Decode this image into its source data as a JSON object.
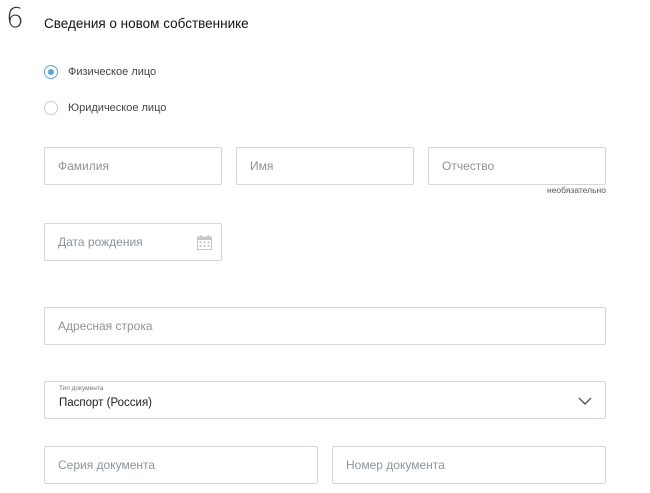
{
  "section": {
    "number": "6",
    "title": "Сведения о новом собственнике"
  },
  "owner_type": {
    "options": [
      {
        "label": "Физическое лицо",
        "selected": true
      },
      {
        "label": "Юридическое лицо",
        "selected": false
      }
    ]
  },
  "fields": {
    "last_name": {
      "placeholder": "Фамилия",
      "value": ""
    },
    "first_name": {
      "placeholder": "Имя",
      "value": ""
    },
    "patronymic": {
      "placeholder": "Отчество",
      "value": "",
      "hint": "необязательно"
    },
    "birth_date": {
      "placeholder": "Дата рождения",
      "value": ""
    },
    "address": {
      "placeholder": "Адресная строка",
      "value": ""
    },
    "document_type": {
      "caption": "Тип документа",
      "value": "Паспорт (Россия)"
    },
    "document_series": {
      "placeholder": "Серия документа",
      "value": ""
    },
    "document_number": {
      "placeholder": "Номер документа",
      "value": ""
    }
  },
  "icons": {
    "calendar": "calendar-icon",
    "chevron": "chevron-down-icon"
  },
  "colors": {
    "accent": "#5aa6d6",
    "border": "#d3d6da",
    "placeholder": "#8e9399"
  }
}
